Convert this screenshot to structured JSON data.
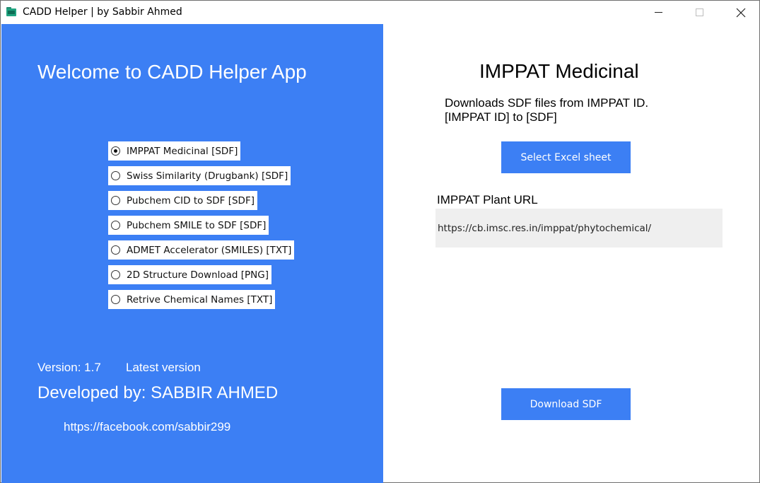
{
  "window": {
    "title": "CADD Helper | by Sabbir Ahmed"
  },
  "left_panel": {
    "welcome": "Welcome to CADD Helper App",
    "options": [
      {
        "label": "IMPPAT Medicinal [SDF]",
        "selected": true
      },
      {
        "label": "Swiss Similarity (Drugbank) [SDF]",
        "selected": false
      },
      {
        "label": "Pubchem CID to SDF [SDF]",
        "selected": false
      },
      {
        "label": "Pubchem SMILE to SDF [SDF]",
        "selected": false
      },
      {
        "label": "ADMET Accelerator (SMILES) [TXT]",
        "selected": false
      },
      {
        "label": "2D Structure Download [PNG]",
        "selected": false
      },
      {
        "label": "Retrive Chemical Names [TXT]",
        "selected": false
      }
    ],
    "version": "Version: 1.7",
    "version_status": "Latest version",
    "developed_by": "Developed by: SABBIR AHMED",
    "facebook": "https://facebook.com/sabbir299"
  },
  "main": {
    "title": "IMPPAT Medicinal",
    "description_line1": "Downloads SDF files from IMPPAT ID.",
    "description_line2": "[IMPPAT ID] to [SDF]",
    "select_button": "Select Excel sheet",
    "url_label": "IMPPAT Plant URL",
    "url_value": "https://cb.imsc.res.in/imppat/phytochemical/",
    "download_button": "Download SDF"
  },
  "colors": {
    "accent": "#3c7ff4",
    "field_bg": "#efefef"
  },
  "icons": [
    "app-folder-icon",
    "minimize-icon",
    "maximize-icon",
    "close-icon",
    "radio-button-icon"
  ]
}
